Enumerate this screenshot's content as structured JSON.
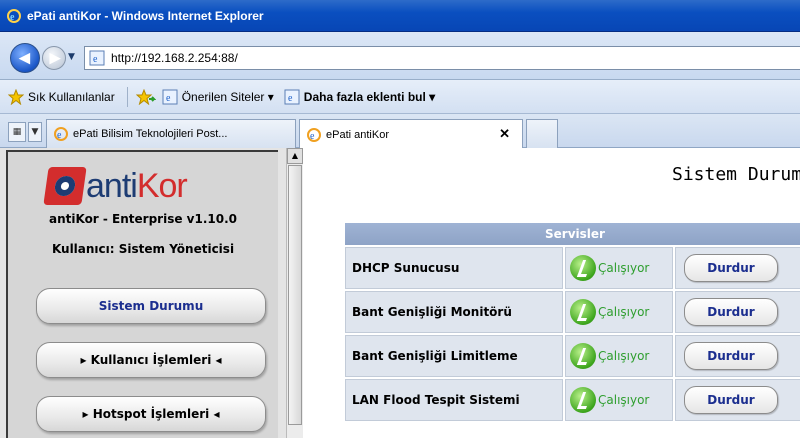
{
  "window": {
    "title": "ePati antiKor - Windows Internet Explorer"
  },
  "address": {
    "url": "http://192.168.2.254:88/"
  },
  "favorites": {
    "label": "Sık Kullanılanlar",
    "items": [
      {
        "label": "Önerilen Siteler ▾"
      },
      {
        "label": "Daha fazla eklenti bul ▾"
      }
    ]
  },
  "tabs": [
    {
      "label": "ePati Bilisim Teknolojileri Post..."
    },
    {
      "label": "ePati antiKor",
      "close": "✕"
    }
  ],
  "sidebar": {
    "logo_part1": "anti",
    "logo_part2": "Kor",
    "version": "antiKor - Enterprise v1.10.0",
    "user": "Kullanıcı: Sistem Yöneticisi",
    "menu": [
      {
        "label": "Sistem Durumu",
        "active": true
      },
      {
        "label": "▸ Kullanıcı İşlemleri ◂"
      },
      {
        "label": "▸ Hotspot İşlemleri ◂"
      }
    ]
  },
  "main": {
    "title": "Sistem Durumu",
    "services": {
      "header": "Servisler",
      "rows": [
        {
          "name": "DHCP Sunucusu",
          "status": "Çalışıyor",
          "action": "Durdur"
        },
        {
          "name": "Bant Genişliği Monitörü",
          "status": "Çalışıyor",
          "action": "Durdur"
        },
        {
          "name": "Bant Genişliği Limitleme",
          "status": "Çalışıyor",
          "action": "Durdur"
        },
        {
          "name": "LAN Flood Tespit Sistemi",
          "status": "Çalışıyor",
          "action": "Durdur"
        }
      ]
    }
  },
  "colors": {
    "accent": "#1b2e8f",
    "running": "#2e9e2e",
    "logo_red": "#d32d2d",
    "logo_blue": "#1d3c73"
  }
}
